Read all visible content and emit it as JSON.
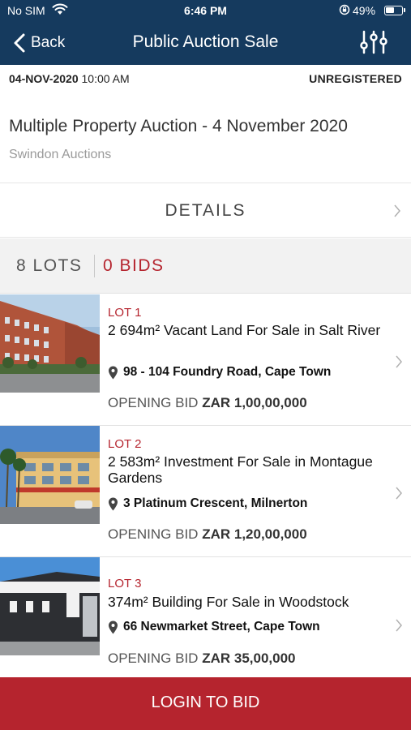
{
  "status_bar": {
    "carrier": "No SIM",
    "time": "6:46 PM",
    "battery": "49%",
    "icons": [
      "wifi-icon",
      "orientation-lock-icon",
      "battery-icon"
    ]
  },
  "nav": {
    "back_label": "Back",
    "title": "Public Auction Sale",
    "filter_icon": "sliders-icon"
  },
  "auction": {
    "date": "04-NOV-2020",
    "time": "10:00 AM",
    "registration": "UNREGISTERED",
    "title": "Multiple Property Auction - 4 November 2020",
    "auctioneer": "Swindon Auctions"
  },
  "details_label": "DETAILS",
  "counts": {
    "lots": "8 LOTS",
    "bids": "0 BIDS"
  },
  "opening_bid_label": "OPENING BID",
  "lots": [
    {
      "number": "LOT 1",
      "title": "2 694m² Vacant Land For Sale in Salt River",
      "address": "98 - 104 Foundry Road, Cape Town",
      "opening_bid": "ZAR 1,00,00,000"
    },
    {
      "number": "LOT 2",
      "title": "2 583m² Investment For Sale in Montague Gardens",
      "address": "3 Platinum Crescent, Milnerton",
      "opening_bid": "ZAR 1,20,00,000"
    },
    {
      "number": "LOT 3",
      "title": "374m² Building For Sale in Woodstock",
      "address": "66 Newmarket Street, Cape Town",
      "opening_bid": "ZAR 35,00,000"
    }
  ],
  "login_label": "LOGIN TO BID",
  "colors": {
    "nav_bg": "#153a5e",
    "accent_red": "#b5242e",
    "counts_bg": "#f2f2f2"
  }
}
